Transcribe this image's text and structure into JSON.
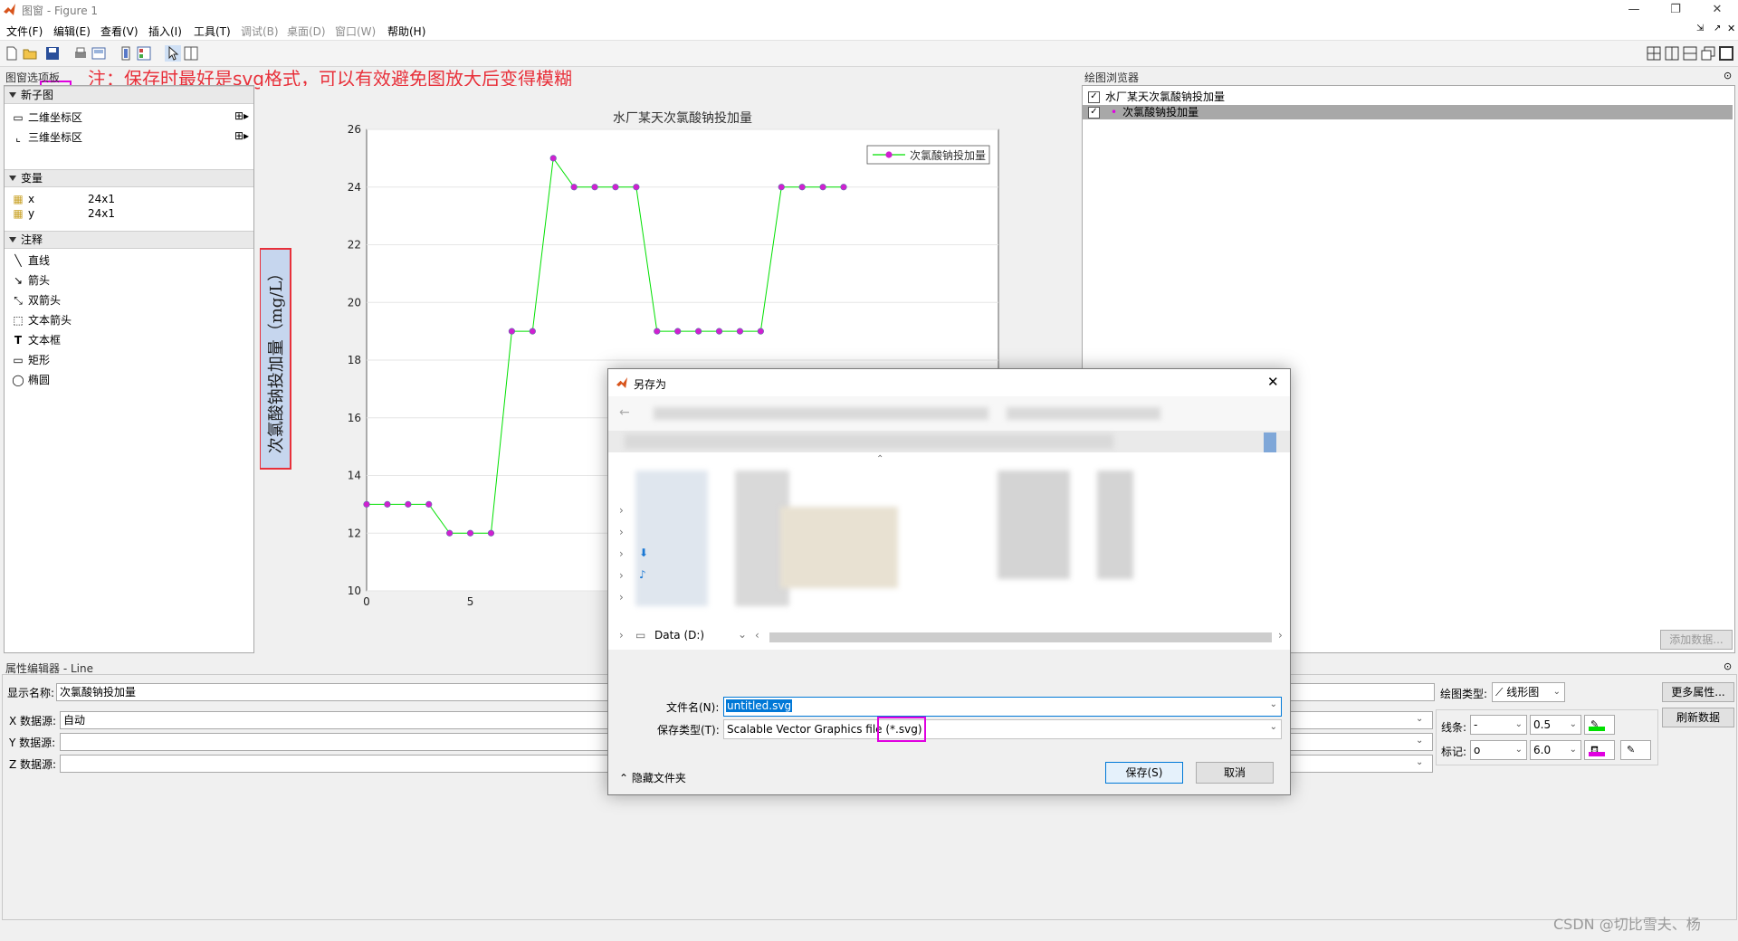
{
  "window": {
    "title": "图窗 - Figure 1"
  },
  "menubar": {
    "items": [
      "文件(F)",
      "编辑(E)",
      "查看(V)",
      "插入(I)",
      "工具(T)",
      "调试(B)",
      "桌面(D)",
      "窗口(W)",
      "帮助(H)"
    ]
  },
  "annotation": {
    "note": "注：保存时最好是svg格式，可以有效避免图放大后变得模糊"
  },
  "figure_palette": {
    "title": "图窗选项板",
    "new_subplot": {
      "header": "新子图",
      "items": [
        "二维坐标区",
        "三维坐标区"
      ]
    },
    "variables": {
      "header": "变量",
      "rows": [
        {
          "name": "x",
          "size": "24x1"
        },
        {
          "name": "y",
          "size": "24x1"
        }
      ]
    },
    "annotations": {
      "header": "注释",
      "items": [
        "直线",
        "箭头",
        "双箭头",
        "文本箭头",
        "文本框",
        "矩形",
        "椭圆"
      ]
    }
  },
  "plot_browser": {
    "title": "绘图浏览器",
    "items": [
      "水厂某天次氯酸钠投加量",
      "次氯酸钠投加量"
    ],
    "add_data_button": "添加数据..."
  },
  "property_editor": {
    "title": "属性编辑器 - Line",
    "display_name_label": "显示名称:",
    "display_name_value": "次氯酸钠投加量",
    "x_source_label": "X 数据源:",
    "x_source_value": "自动",
    "y_source_label": "Y 数据源:",
    "z_source_label": "Z 数据源:",
    "plot_type_label": "绘图类型:",
    "plot_type_value": "线形图",
    "line_label": "线条:",
    "line_style": "-",
    "line_width": "0.5",
    "marker_label": "标记:",
    "marker_style": "o",
    "marker_size": "6.0",
    "more_props_button": "更多属性...",
    "refresh_button": "刷新数据",
    "line_color": "#00e000",
    "marker_color": "#e000e0"
  },
  "save_dialog": {
    "title": "另存为",
    "drive_label": "Data (D:)",
    "filename_label": "文件名(N):",
    "filename_value": "untitled.svg",
    "filetype_label": "保存类型(T):",
    "filetype_value": "Scalable Vector Graphics file (*.svg)",
    "hide_folders": "隐藏文件夹",
    "save_button": "保存(S)",
    "cancel_button": "取消"
  },
  "watermark": "CSDN @切比雪夫、杨",
  "chart_data": {
    "type": "line",
    "title": "水厂某天次氯酸钠投加量",
    "ylabel": "次氯酸钠投加量（mg/L）",
    "xlabel": "",
    "xlim": [
      0,
      23
    ],
    "ylim": [
      10,
      26
    ],
    "yticks": [
      10,
      12,
      14,
      16,
      18,
      20,
      22,
      24,
      26
    ],
    "xticks": [
      0,
      5
    ],
    "grid": "horizontal",
    "legend": "top-right",
    "series": [
      {
        "name": "次氯酸钠投加量",
        "color": "#00e000",
        "marker_color": "#d020d0",
        "x": [
          0,
          1,
          2,
          3,
          4,
          5,
          6,
          7,
          8,
          9,
          10,
          11,
          12,
          13,
          14,
          15,
          16,
          17,
          18,
          19,
          20,
          21,
          22,
          23
        ],
        "values": [
          13,
          13,
          13,
          13,
          12,
          12,
          12,
          19,
          19,
          25,
          24,
          24,
          24,
          24,
          19,
          19,
          19,
          19,
          19,
          19,
          24,
          24,
          24,
          24
        ]
      }
    ]
  }
}
